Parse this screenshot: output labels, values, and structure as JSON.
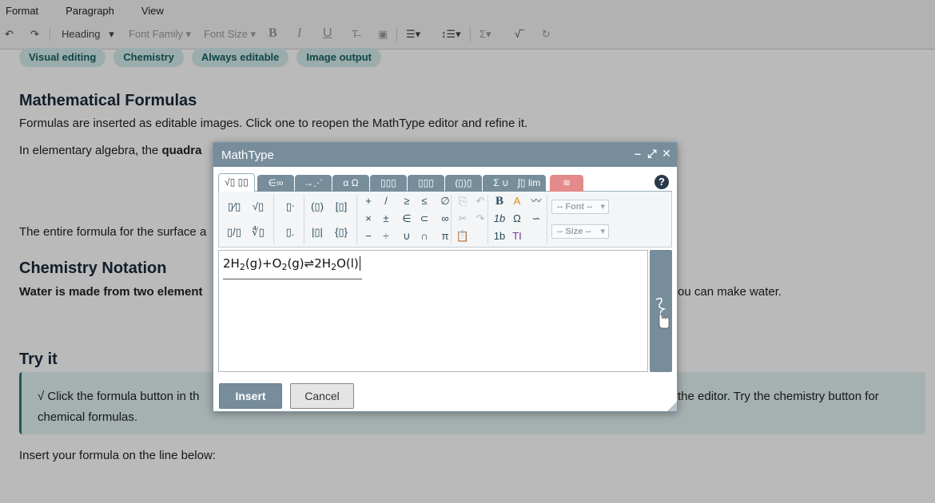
{
  "menu": [
    "Format",
    "Paragraph",
    "View"
  ],
  "toolbar": {
    "undo_icon": "undo-icon",
    "redo_icon": "redo-icon",
    "heading": "Heading",
    "font_family": "Font Family",
    "font_size": "Font Size",
    "bold": "B",
    "italic": "I",
    "underline": "U"
  },
  "tags": [
    "Visual editing",
    "Chemistry",
    "Always editable",
    "Image output"
  ],
  "sections": {
    "math_title": "Mathematical Formulas",
    "math_p1": "Formulas are inserted as editable images. Click one to reopen the MathType editor and refine it.",
    "math_p2_a": "In elementary algebra, the ",
    "math_p2_b": "quadra",
    "math_p3": "The entire formula for the surface a",
    "chem_title": "Chemistry Notation",
    "chem_p_a": "Water is made from two element",
    "chem_p_b": "ou can make water.",
    "try_title": "Try it",
    "tip_a": "√ Click the formula button in th",
    "tip_b": "the editor. Try the chemistry button for",
    "tip_c": "chemical formulas.",
    "insert_line": "Insert your formula on the line below:"
  },
  "dialog": {
    "title": "MathType",
    "help": "?",
    "tabs": [
      "√▯ ▯▯",
      "∈∞",
      "→⋰",
      "α Ω",
      "▯▯▯",
      "▯▯▯",
      "(▯)▯",
      "Σ ∪",
      "∫▯ lim",
      "≋"
    ],
    "palette": {
      "ops_row1": [
        "+",
        "/",
        "≥",
        "≤",
        "∅"
      ],
      "ops_row2": [
        "×",
        "±",
        "∈",
        "⊂",
        "∞"
      ],
      "ops_row3": [
        "−",
        "÷",
        "∪",
        "∩",
        "π"
      ],
      "font_select": "-- Font --",
      "size_select": "-- Size --",
      "bold_btn": "B",
      "italic_btn": "1b",
      "normal_btn": "1b",
      "text_btn": "T"
    },
    "formula": {
      "part1": "2H",
      "sub1": "2",
      "part2": "(g)+O",
      "sub2": "2",
      "part3": "(g)⇌2H",
      "sub3": "2",
      "part4": "O(l)"
    },
    "insert": "Insert",
    "cancel": "Cancel"
  },
  "colors": {
    "accent": "#778d9c",
    "tag_bg": "#d5ecec",
    "tag_text": "#166060",
    "overlay": "rgba(0,0,0,0.27)"
  }
}
